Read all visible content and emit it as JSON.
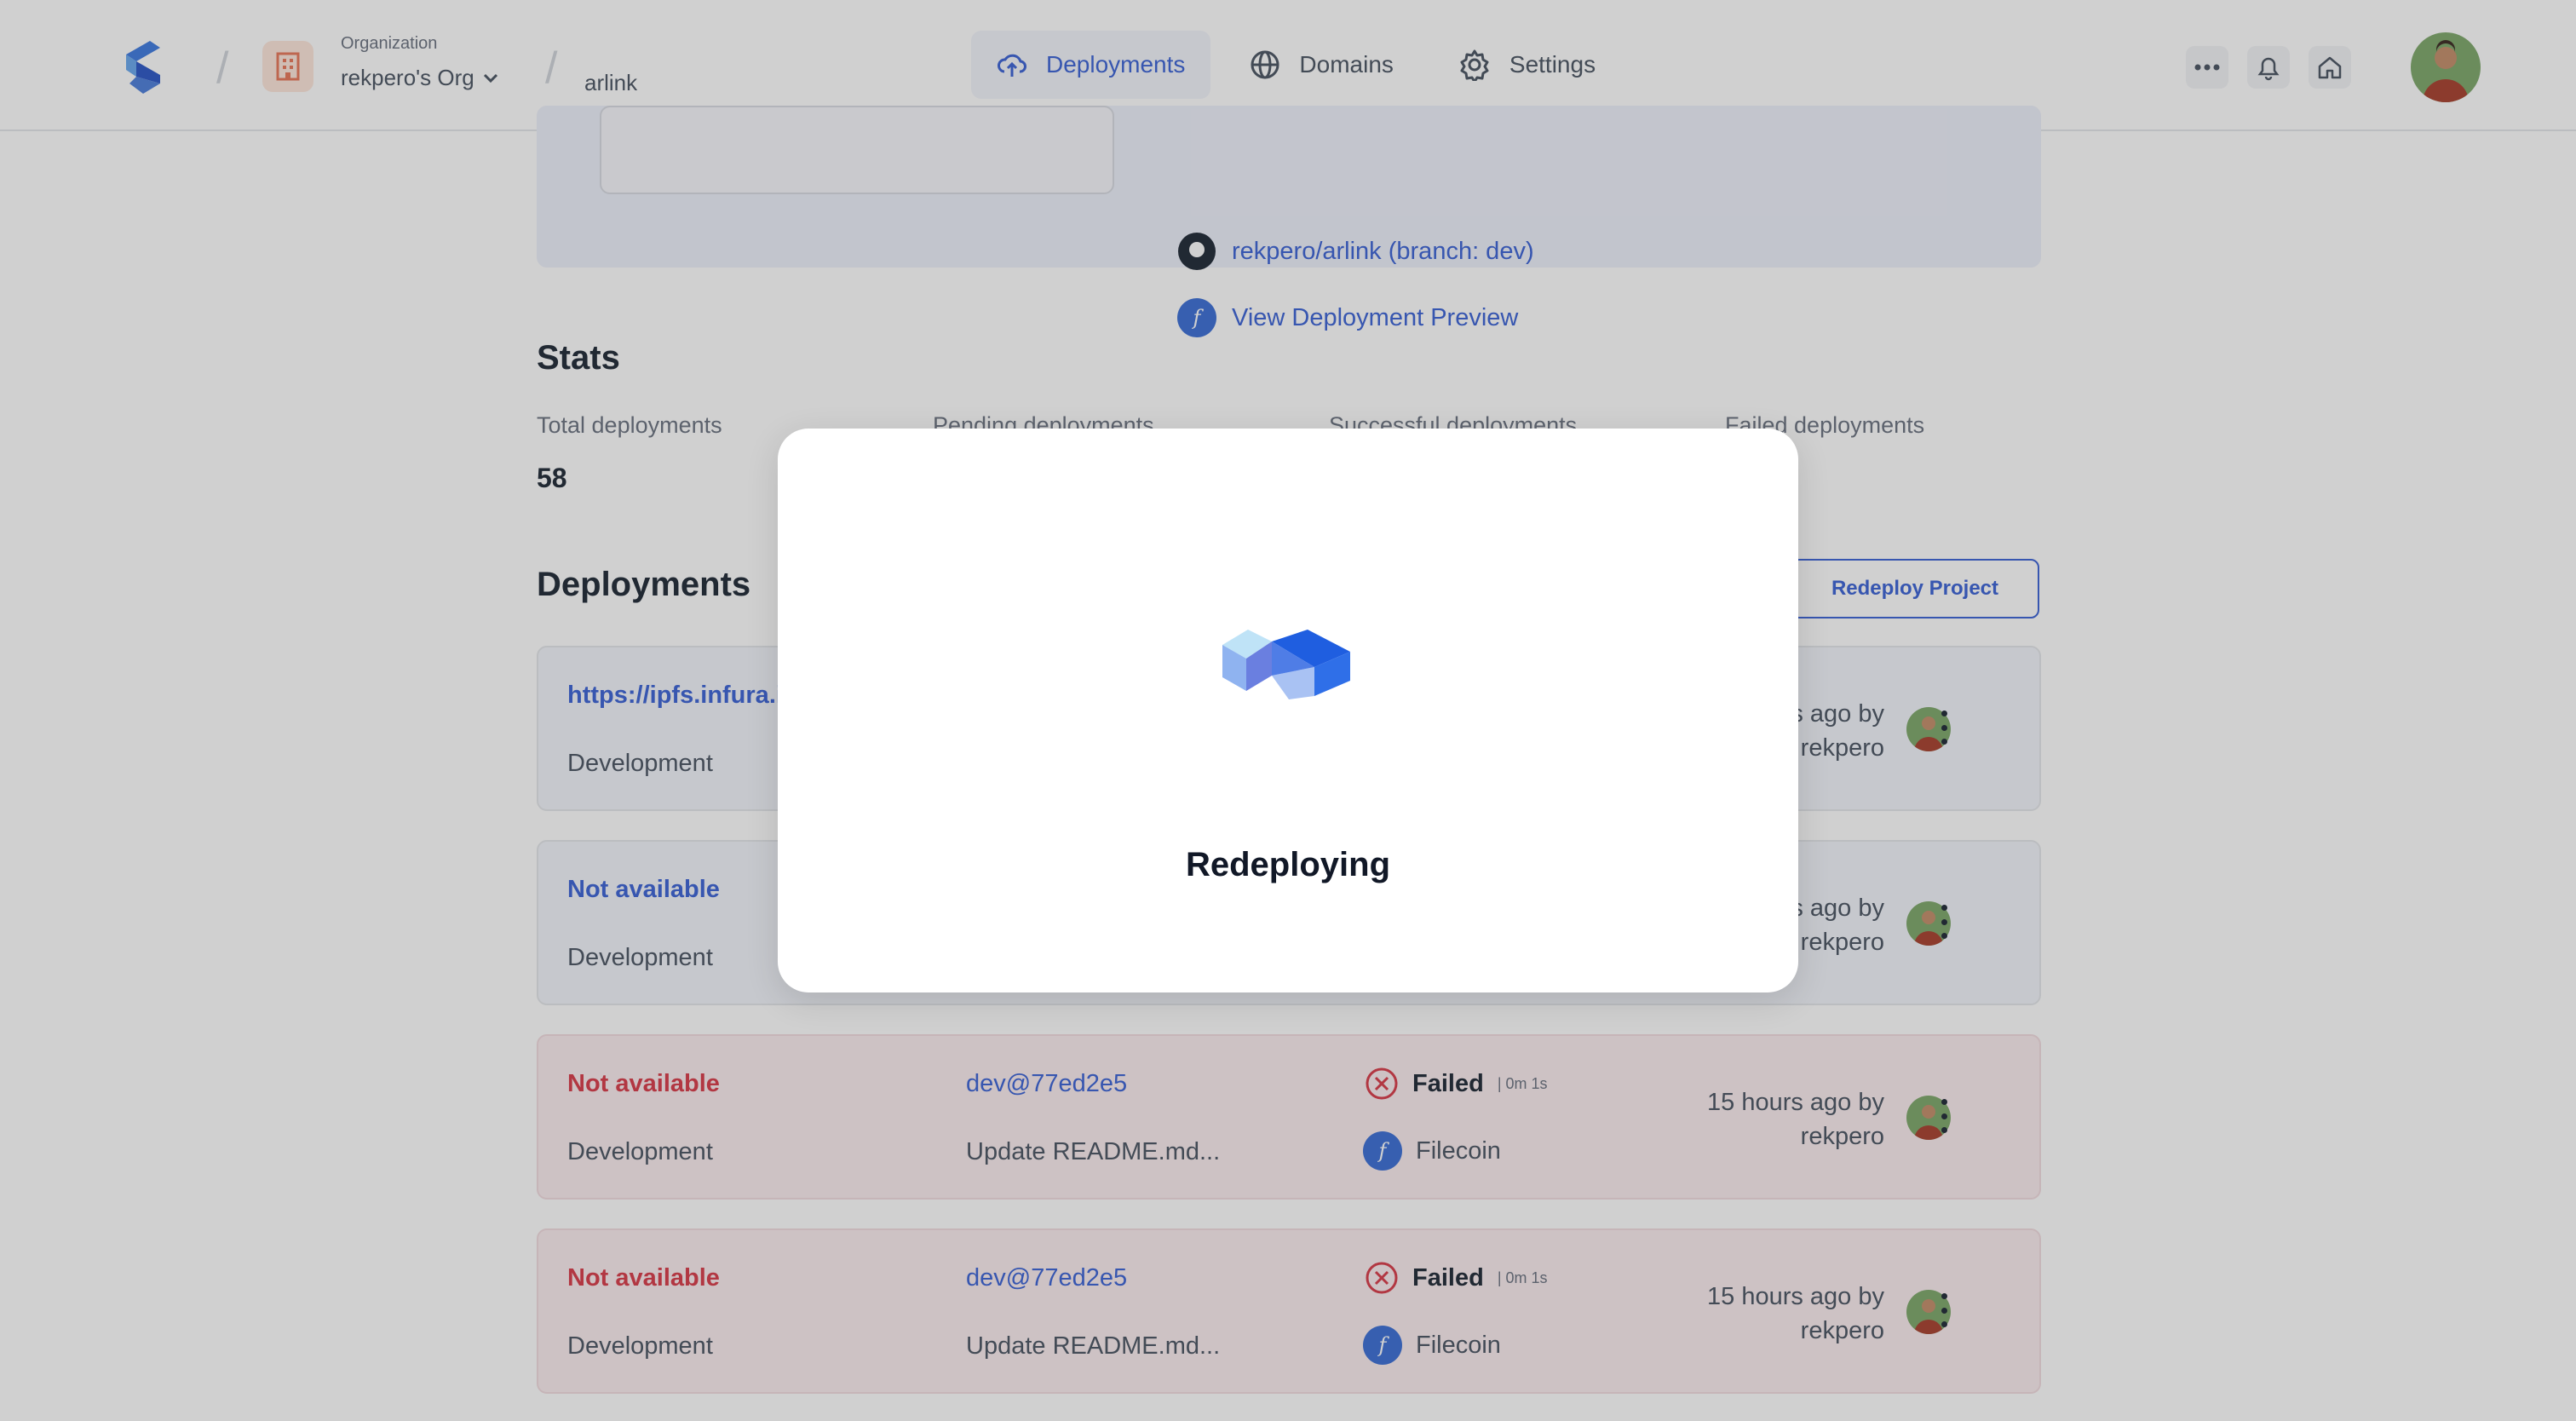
{
  "header": {
    "org_caption": "Organization",
    "org_name": "rekpero's Org",
    "project_name": "arlink",
    "nav": [
      {
        "label": "Deployments",
        "icon": "cloud-upload-icon",
        "active": true
      },
      {
        "label": "Domains",
        "icon": "globe-icon",
        "active": false
      },
      {
        "label": "Settings",
        "icon": "gear-icon",
        "active": false
      }
    ]
  },
  "project_card": {
    "repo_link": "rekpero/arlink (branch: dev)",
    "preview_link": "View Deployment Preview"
  },
  "stats": {
    "title": "Stats",
    "items": [
      {
        "label": "Total deployments",
        "value": "58"
      },
      {
        "label": "Pending deployments",
        "value": ""
      },
      {
        "label": "Successful deployments",
        "value": ""
      },
      {
        "label": "Failed deployments",
        "value": ""
      }
    ]
  },
  "deployments": {
    "title": "Deployments",
    "redeploy_label": "Redeploy Project",
    "rows": [
      {
        "url": "https://ipfs.infura.i",
        "env": "Development",
        "time_line1": "s ago by",
        "time_line2": "rekpero",
        "state": "success"
      },
      {
        "url": "Not available",
        "env": "Development",
        "time_line1": "s ago by",
        "time_line2": "rekpero",
        "state": "pending"
      },
      {
        "url": "Not available",
        "env": "Development",
        "commit": "dev@77ed2e5",
        "message": "Update README.md...",
        "status": "Failed",
        "duration": "| 0m 1s",
        "network": "Filecoin",
        "time_line1": "15 hours ago by",
        "time_line2": "rekpero",
        "state": "failed"
      },
      {
        "url": "Not available",
        "env": "Development",
        "commit": "dev@77ed2e5",
        "message": "Update README.md...",
        "status": "Failed",
        "duration": "| 0m 1s",
        "network": "Filecoin",
        "time_line1": "15 hours ago by",
        "time_line2": "rekpero",
        "state": "failed"
      }
    ]
  },
  "modal": {
    "title": "Redeploying"
  },
  "colors": {
    "accent": "#3b63d6",
    "danger": "#d93c4a",
    "overlay": "rgba(40,40,40,0.22)"
  }
}
